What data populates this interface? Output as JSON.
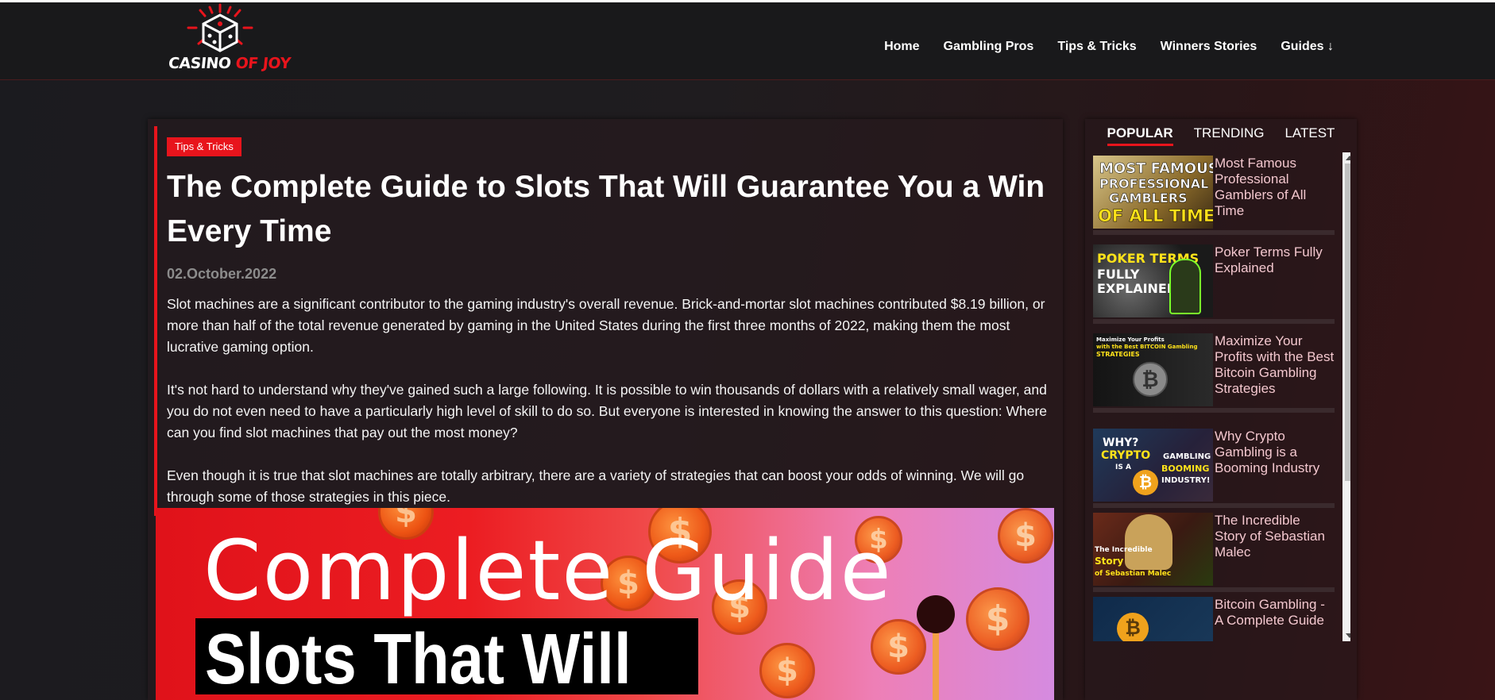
{
  "brand": {
    "logo_part1": "CASINO ",
    "logo_part2": "OF JOY",
    "accent": "#e8141c"
  },
  "nav": {
    "items": [
      {
        "label": "Home"
      },
      {
        "label": "Gambling Pros"
      },
      {
        "label": "Tips & Tricks"
      },
      {
        "label": "Winners Stories"
      },
      {
        "label": "Guides ↓"
      }
    ]
  },
  "article": {
    "category": "Tips & Tricks",
    "title": "The Complete Guide to Slots That Will Guarantee You a Win Every Time",
    "date": "02.October.2022",
    "paragraphs": [
      "Slot machines are a significant contributor to the gaming industry's overall revenue. Brick-and-mortar slot machines contributed $8.19 billion, or more than half of the total revenue generated by gaming in the United States during the first three months of 2022, making them the most lucrative gaming option.",
      "It's not hard to understand why they've gained such a large following. It is possible to win thousands of dollars with a relatively small wager, and you do not even need to have a particularly high level of skill to do so. But everyone is interested in knowing the answer to this question: Where can you find slot machines that pay out the most money?",
      "Even though it is true that slot machines are totally arbitrary, there are a variety of strategies that can boost your odds of winning. We will go through some of those strategies in this piece."
    ],
    "hero": {
      "line1": "Complete Guide",
      "line2": "Slots That Will"
    }
  },
  "sidebar": {
    "tabs": [
      {
        "label": "POPULAR",
        "active": true
      },
      {
        "label": "TRENDING",
        "active": false
      },
      {
        "label": "LATEST",
        "active": false
      }
    ],
    "items": [
      {
        "title": "Most Famous Professional Gamblers of All Time",
        "thumb": [
          "MOST FAMOUS",
          "PROFESSIONAL",
          "GAMBLERS",
          "OF ALL TIME"
        ]
      },
      {
        "title": "Poker Terms Fully Explained",
        "thumb": [
          "POKER TERMS",
          "FULLY",
          "EXPLAINED"
        ]
      },
      {
        "title": "Maximize Your Profits with the Best Bitcoin Gambling Strategies",
        "thumb": [
          "Maximize Your Profits",
          "with the Best BITCOIN Gambling",
          "STRATEGIES"
        ]
      },
      {
        "title": "Why Crypto Gambling is a Booming Industry",
        "thumb": [
          "WHY?",
          "CRYPTO",
          "IS A",
          "GAMBLING",
          "BOOMING",
          "INDUSTRY!"
        ]
      },
      {
        "title": "The Incredible Story of Sebastian Malec",
        "thumb": [
          "The Incredible",
          "Story",
          "of Sebastian Malec"
        ]
      },
      {
        "title": "Bitcoin Gambling - A Complete Guide",
        "thumb": []
      }
    ]
  }
}
